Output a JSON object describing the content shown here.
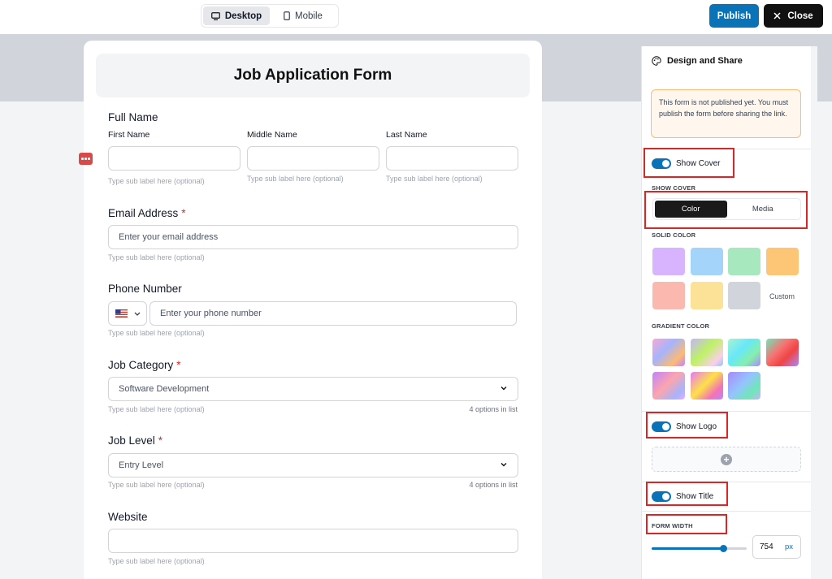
{
  "topbar": {
    "view_desktop": "Desktop",
    "view_mobile": "Mobile",
    "publish_label": "Publish",
    "close_label": "Close"
  },
  "form": {
    "title": "Job Application Form",
    "full_name": {
      "label": "Full Name",
      "first": "First Name",
      "middle": "Middle Name",
      "last": "Last Name",
      "hint": "Type sub label here (optional)"
    },
    "email": {
      "label": "Email Address",
      "required_mark": "*",
      "placeholder": "Enter your email address",
      "hint": "Type sub label here (optional)"
    },
    "phone": {
      "label": "Phone Number",
      "placeholder": "Enter your phone number",
      "hint": "Type sub label here (optional)"
    },
    "job_category": {
      "label": "Job Category",
      "required_mark": "*",
      "value": "Software Development",
      "hint": "Type sub label here (optional)",
      "count": "4 options in list"
    },
    "job_level": {
      "label": "Job Level",
      "required_mark": "*",
      "value": "Entry Level",
      "hint": "Type sub label here (optional)",
      "count": "4 options in list"
    },
    "website": {
      "label": "Website",
      "hint": "Type sub label here (optional)"
    }
  },
  "panel": {
    "title": "Design and Share",
    "notice": "This form is not published yet. You must publish the form before sharing the link.",
    "show_cover": "Show Cover",
    "show_cover_section": "SHOW COVER",
    "cover_color": "Color",
    "cover_media": "Media",
    "solid_color_section": "SOLID COLOR",
    "custom_label": "Custom",
    "gradient_color_section": "GRADIENT COLOR",
    "show_logo": "Show Logo",
    "show_title": "Show Title",
    "form_width_section": "FORM WIDTH",
    "form_width_value": "754",
    "form_width_unit": "px",
    "form_width_fraction": 0.76
  },
  "colors": {
    "accent": "#0a73b7",
    "solid": [
      "#d8b4fe",
      "#a5d4fa",
      "#a7e8be",
      "#fdc676",
      "#fbb8ae",
      "#fbe296",
      "#d1d5db"
    ]
  }
}
